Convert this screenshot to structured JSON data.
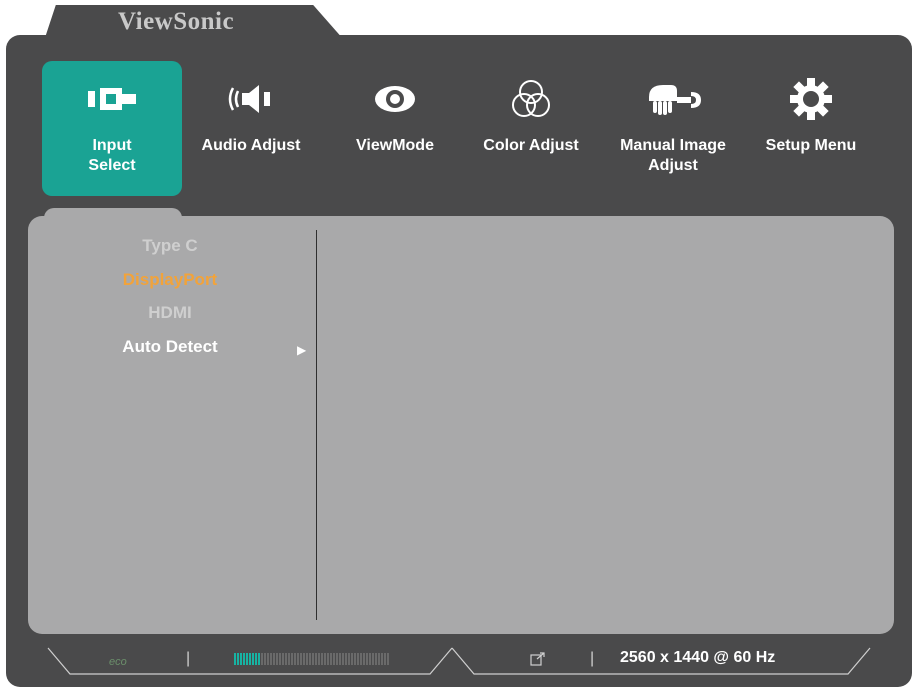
{
  "brand": "ViewSonic",
  "menu": [
    {
      "label": "Input Select",
      "icon": "input-select-icon",
      "active": true
    },
    {
      "label": "Audio Adjust",
      "icon": "speaker-icon",
      "active": false
    },
    {
      "label": "ViewMode",
      "icon": "eye-icon",
      "active": false
    },
    {
      "label": "Color Adjust",
      "icon": "color-circles-icon",
      "active": false
    },
    {
      "label": "Manual Image Adjust",
      "icon": "hand-wrench-icon",
      "active": false
    },
    {
      "label": "Setup Menu",
      "icon": "gear-icon",
      "active": false
    }
  ],
  "input_options": [
    {
      "label": "Type C",
      "state": "dim"
    },
    {
      "label": "DisplayPort",
      "state": "selected"
    },
    {
      "label": "HDMI",
      "state": "dim"
    },
    {
      "label": "Auto Detect",
      "state": "focused"
    }
  ],
  "status_bar": {
    "eco_label": "eco",
    "resolution": "2560 x 1440 @ 60 Hz",
    "level_fraction": 0.17
  },
  "colors": {
    "active_accent": "#1aa394",
    "selected_option": "#f2a33a",
    "frame": "#4a4a4b",
    "panel": "#a9a9aa"
  }
}
